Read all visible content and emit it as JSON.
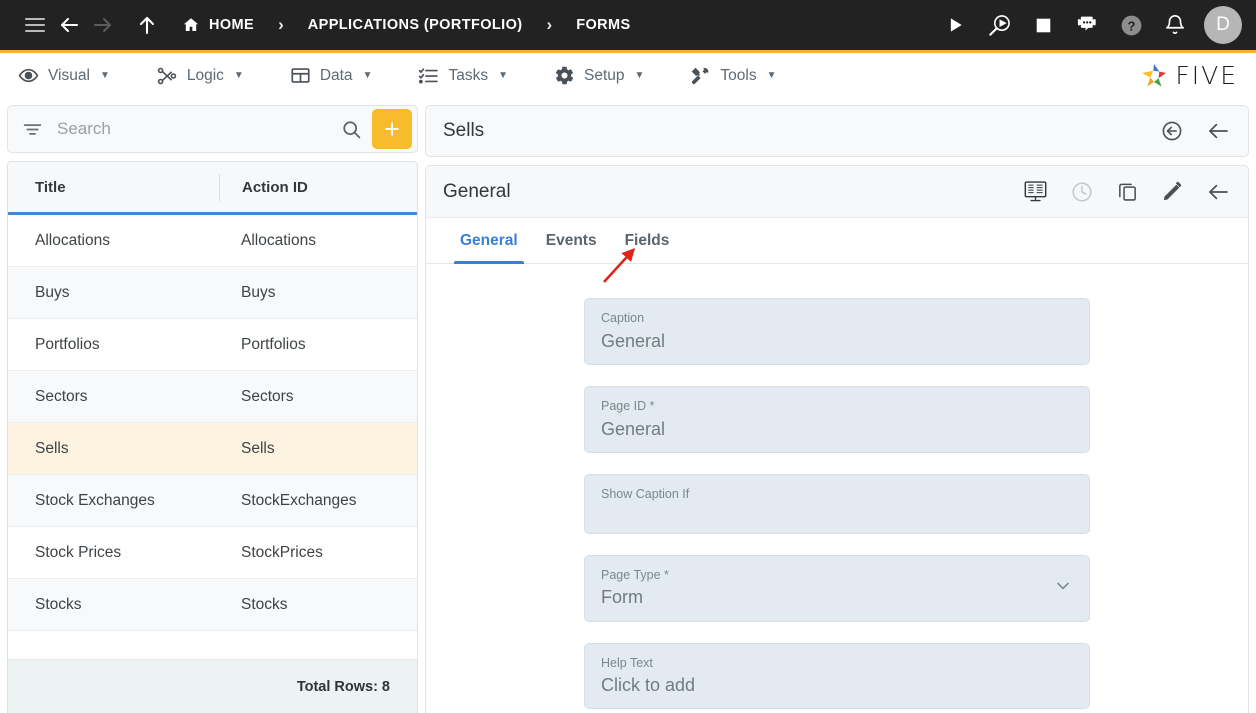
{
  "topbar": {
    "menu_icon": "hamburger-icon",
    "back_icon": "back-arrow-icon",
    "forward_icon": "forward-arrow-icon",
    "up_icon": "up-arrow-icon",
    "home_icon": "home-icon",
    "breadcrumbs": [
      {
        "label": "HOME",
        "icon": "home-icon"
      },
      {
        "label": "APPLICATIONS (PORTFOLIO)",
        "icon": ""
      },
      {
        "label": "FORMS",
        "icon": ""
      }
    ],
    "separator": "›",
    "actions": [
      {
        "name": "run-icon"
      },
      {
        "name": "debug-run-icon"
      },
      {
        "name": "stop-icon"
      },
      {
        "name": "chatbot-icon"
      },
      {
        "name": "help-icon"
      },
      {
        "name": "notifications-bell-icon"
      }
    ],
    "avatar_initial": "D",
    "accent_bar_color": "#f5b32e",
    "background_color": "#222222"
  },
  "menubar": {
    "items": [
      {
        "label": "Visual",
        "icon": "eye-icon",
        "caret": "▼"
      },
      {
        "label": "Logic",
        "icon": "logic-nodes-icon",
        "caret": "▼"
      },
      {
        "label": "Data",
        "icon": "table-grid-icon",
        "caret": "▼"
      },
      {
        "label": "Tasks",
        "icon": "checklist-icon",
        "caret": "▼"
      },
      {
        "label": "Setup",
        "icon": "gear-icon",
        "caret": "▼"
      },
      {
        "label": "Tools",
        "icon": "tools-icon",
        "caret": "▼"
      }
    ],
    "logo_text": "FIVE"
  },
  "sidebar": {
    "search": {
      "placeholder": "Search",
      "value": "",
      "filter_icon": "filter-icon",
      "search_icon": "search-icon"
    },
    "add_button_label": "+",
    "add_button_color": "#f8bb2c",
    "columns": [
      "Title",
      "Action ID"
    ],
    "header_underline_color": "#4387d6",
    "selected_row_color": "#fdf3e1",
    "rows": [
      {
        "title": "Allocations",
        "action_id": "Allocations",
        "selected": false
      },
      {
        "title": "Buys",
        "action_id": "Buys",
        "selected": false
      },
      {
        "title": "Portfolios",
        "action_id": "Portfolios",
        "selected": false
      },
      {
        "title": "Sectors",
        "action_id": "Sectors",
        "selected": false
      },
      {
        "title": "Sells",
        "action_id": "Sells",
        "selected": true
      },
      {
        "title": "Stock Exchanges",
        "action_id": "StockExchanges",
        "selected": false
      },
      {
        "title": "Stock Prices",
        "action_id": "StockPrices",
        "selected": false
      },
      {
        "title": "Stocks",
        "action_id": "Stocks",
        "selected": false
      },
      {
        "title": "",
        "action_id": "",
        "selected": false
      }
    ],
    "footer_text": "Total Rows: 8"
  },
  "main": {
    "record_title": "Sells",
    "record_actions": [
      {
        "name": "revert-circle-icon"
      },
      {
        "name": "close-back-arrow-icon"
      }
    ],
    "page_title": "General",
    "page_actions": [
      {
        "name": "preview-display-icon",
        "disabled": false
      },
      {
        "name": "history-clock-icon",
        "disabled": true
      },
      {
        "name": "duplicate-copy-icon",
        "disabled": false
      },
      {
        "name": "edit-pencil-icon",
        "disabled": false
      },
      {
        "name": "close-back-arrow-icon",
        "disabled": false
      }
    ],
    "tabs": [
      {
        "label": "General",
        "active": true
      },
      {
        "label": "Events",
        "active": false
      },
      {
        "label": "Fields",
        "active": false
      }
    ],
    "active_tab_color": "#3b7fd4",
    "annotation": {
      "type": "red-arrow",
      "points_to": "Fields",
      "color": "#e32119"
    },
    "fields": [
      {
        "label": "Caption",
        "value": "General",
        "type": "text",
        "required": false
      },
      {
        "label": "Page ID *",
        "value": "General",
        "type": "text",
        "required": true
      },
      {
        "label": "Show Caption If",
        "value": "",
        "type": "text",
        "required": false
      },
      {
        "label": "Page Type *",
        "value": "Form",
        "type": "select",
        "required": true
      },
      {
        "label": "Help Text",
        "value": "Click to add",
        "type": "text",
        "required": false
      }
    ]
  }
}
